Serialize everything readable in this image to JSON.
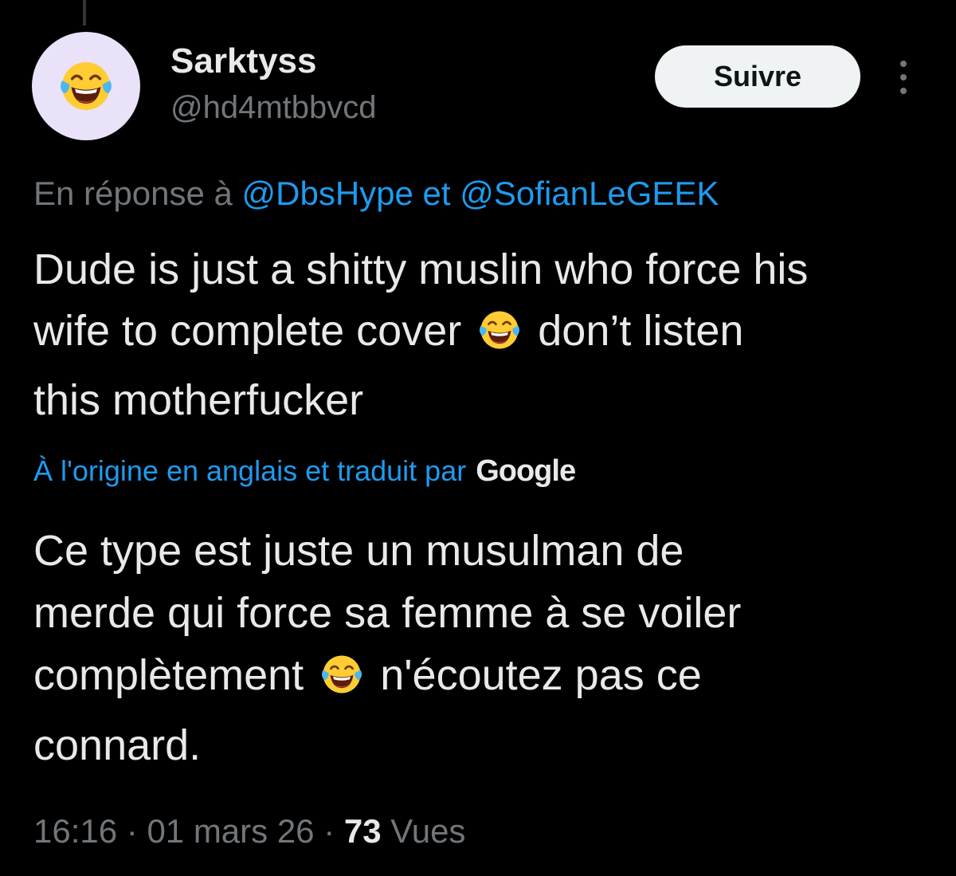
{
  "author": {
    "display_name": "Sarktyss",
    "handle": "@hd4mtbbvcd",
    "avatar_icon": "laughing-tears-emoji"
  },
  "actions": {
    "follow_label": "Suivre",
    "more_icon": "vertical-ellipsis-icon"
  },
  "reply": {
    "prefix": "En réponse à ",
    "mention_1": "@DbsHype",
    "joiner": " et ",
    "mention_2": "@SofianLeGEEK"
  },
  "tweet": {
    "line_1": "Dude is just a shitty muslin who force his",
    "line_2a": "wife to complete cover",
    "line_2b": "don’t listen",
    "line_3": "this motherfucker",
    "emoji": "face-with-tears-of-joy"
  },
  "translation": {
    "note": "À l'origine en anglais et traduit par",
    "provider": "Google",
    "line_1": "Ce type est juste un musulman de",
    "line_2": "merde qui force sa femme à se voiler",
    "line_3a": "complètement",
    "line_3b": "n'écoutez pas ce",
    "line_4": "connard."
  },
  "meta": {
    "time": "16:16",
    "separator": " · ",
    "date": "01 mars 26",
    "views_count": "73",
    "views_label": " Vues"
  },
  "colors": {
    "background": "#000000",
    "text": "#e7e9ea",
    "secondary": "#71767b",
    "accent": "#1d9bf0",
    "avatar_bg": "#eae2f8"
  }
}
